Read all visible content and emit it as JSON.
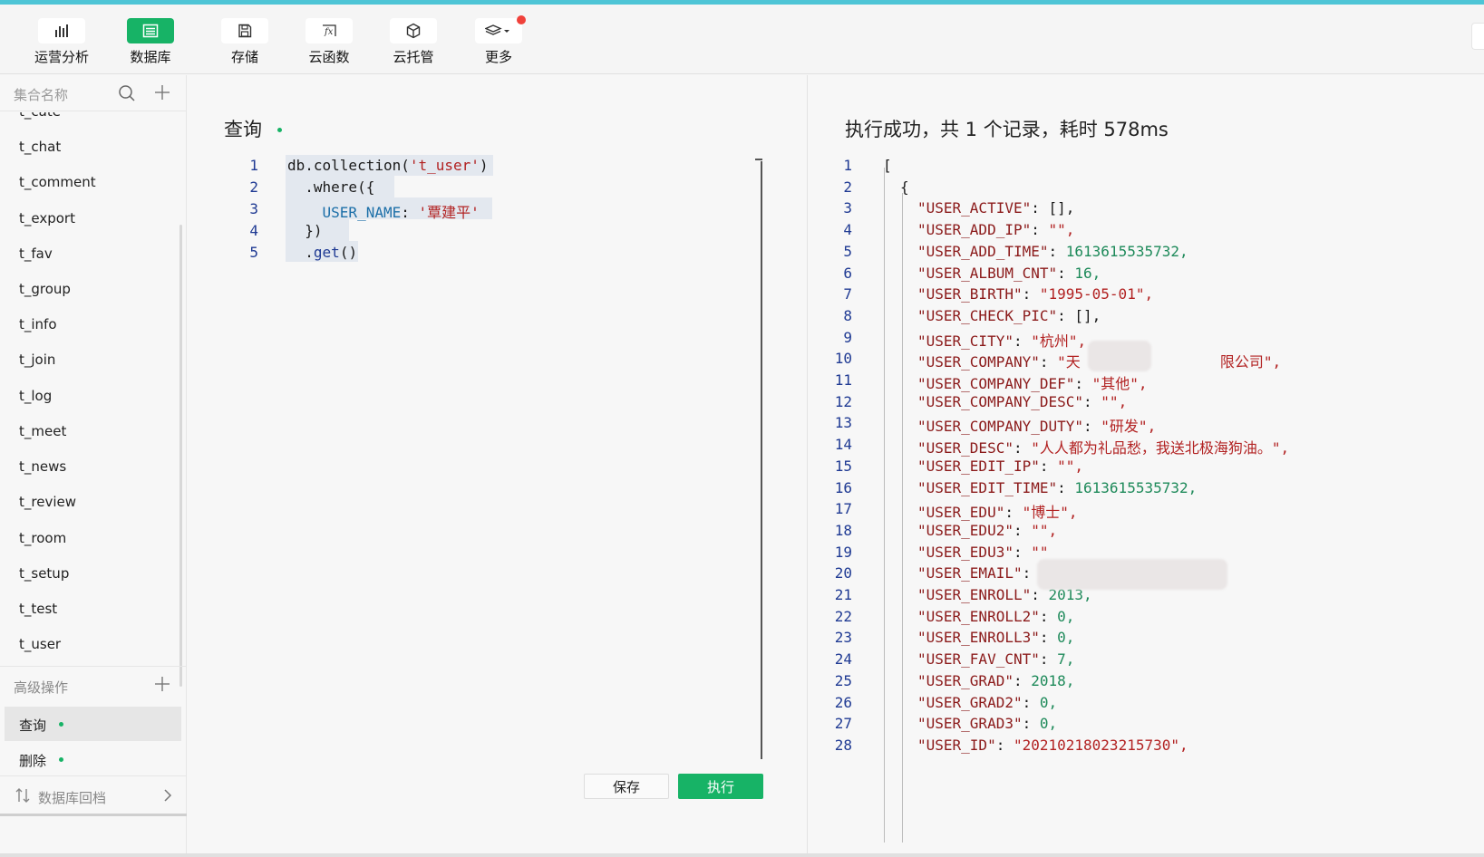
{
  "toolbar": {
    "items": [
      {
        "label": "运营分析",
        "icon": "bar-chart-icon"
      },
      {
        "label": "数据库",
        "icon": "database-icon",
        "active": true
      },
      {
        "label": "存储",
        "icon": "save-icon"
      },
      {
        "label": "云函数",
        "icon": "function-icon"
      },
      {
        "label": "云托管",
        "icon": "cube-icon"
      },
      {
        "label": "更多",
        "icon": "layers-icon"
      }
    ],
    "accent": "#17b366",
    "notify_color": "#f0413a"
  },
  "sidebar": {
    "search_placeholder": "集合名称",
    "collections": [
      "t_cate",
      "t_chat",
      "t_comment",
      "t_export",
      "t_fav",
      "t_group",
      "t_info",
      "t_join",
      "t_log",
      "t_meet",
      "t_news",
      "t_review",
      "t_room",
      "t_setup",
      "t_test",
      "t_user"
    ],
    "advanced_label": "高级操作",
    "operations": [
      {
        "label": "查询",
        "selected": true
      },
      {
        "label": "删除",
        "selected": false
      }
    ],
    "rollback_label": "数据库回档"
  },
  "editor": {
    "title": "查询",
    "line_numbers": [
      "1",
      "2",
      "3",
      "4",
      "5"
    ],
    "lines": [
      {
        "a": "db.collection(",
        "b": "'t_user'",
        "c": ")"
      },
      {
        "a": "  .where({"
      },
      {
        "a": "    ",
        "b": "USER_NAME",
        "c": ": ",
        "d": "'覃建平'"
      },
      {
        "a": "  })"
      },
      {
        "a": "  .",
        "b": "get",
        "c": "()"
      }
    ],
    "save_label": "保存",
    "run_label": "执行"
  },
  "result": {
    "title": "执行成功，共 1 个记录，耗时 578ms",
    "lines": [
      {
        "n": "1",
        "indent": 0,
        "raw": "["
      },
      {
        "n": "2",
        "indent": 1,
        "raw": "{"
      },
      {
        "n": "3",
        "indent": 2,
        "k": "\"USER_ACTIVE\"",
        "v": "[],",
        "t": "p"
      },
      {
        "n": "4",
        "indent": 2,
        "k": "\"USER_ADD_IP\"",
        "v": "\"\",",
        "t": "s"
      },
      {
        "n": "5",
        "indent": 2,
        "k": "\"USER_ADD_TIME\"",
        "v": "1613615535732,",
        "t": "n"
      },
      {
        "n": "6",
        "indent": 2,
        "k": "\"USER_ALBUM_CNT\"",
        "v": "16,",
        "t": "n"
      },
      {
        "n": "7",
        "indent": 2,
        "k": "\"USER_BIRTH\"",
        "v": "\"1995-05-01\",",
        "t": "s"
      },
      {
        "n": "8",
        "indent": 2,
        "k": "\"USER_CHECK_PIC\"",
        "v": "[],",
        "t": "p"
      },
      {
        "n": "9",
        "indent": 2,
        "k": "\"USER_CITY\"",
        "v": "\"杭州\",",
        "t": "s"
      },
      {
        "n": "10",
        "indent": 2,
        "k": "\"USER_COMPANY\"",
        "v": "\"天                限公司\",",
        "t": "s"
      },
      {
        "n": "11",
        "indent": 2,
        "k": "\"USER_COMPANY_DEF\"",
        "v": "\"其他\",",
        "t": "s"
      },
      {
        "n": "12",
        "indent": 2,
        "k": "\"USER_COMPANY_DESC\"",
        "v": "\"\",",
        "t": "s"
      },
      {
        "n": "13",
        "indent": 2,
        "k": "\"USER_COMPANY_DUTY\"",
        "v": "\"研发\",",
        "t": "s"
      },
      {
        "n": "14",
        "indent": 2,
        "k": "\"USER_DESC\"",
        "v": "\"人人都为礼品愁，我送北极海狗油。\",",
        "t": "s"
      },
      {
        "n": "15",
        "indent": 2,
        "k": "\"USER_EDIT_IP\"",
        "v": "\"\",",
        "t": "s"
      },
      {
        "n": "16",
        "indent": 2,
        "k": "\"USER_EDIT_TIME\"",
        "v": "1613615535732,",
        "t": "n"
      },
      {
        "n": "17",
        "indent": 2,
        "k": "\"USER_EDU\"",
        "v": "\"博士\",",
        "t": "s"
      },
      {
        "n": "18",
        "indent": 2,
        "k": "\"USER_EDU2\"",
        "v": "\"\",",
        "t": "s"
      },
      {
        "n": "19",
        "indent": 2,
        "k": "\"USER_EDU3\"",
        "v": "\"\"",
        "t": "s"
      },
      {
        "n": "20",
        "indent": 2,
        "k": "\"USER_EMAIL\"",
        "v": "",
        "t": "s"
      },
      {
        "n": "21",
        "indent": 2,
        "k": "\"USER_ENROLL\"",
        "v": "2013,",
        "t": "n"
      },
      {
        "n": "22",
        "indent": 2,
        "k": "\"USER_ENROLL2\"",
        "v": "0,",
        "t": "n"
      },
      {
        "n": "23",
        "indent": 2,
        "k": "\"USER_ENROLL3\"",
        "v": "0,",
        "t": "n"
      },
      {
        "n": "24",
        "indent": 2,
        "k": "\"USER_FAV_CNT\"",
        "v": "7,",
        "t": "n"
      },
      {
        "n": "25",
        "indent": 2,
        "k": "\"USER_GRAD\"",
        "v": "2018,",
        "t": "n"
      },
      {
        "n": "26",
        "indent": 2,
        "k": "\"USER_GRAD2\"",
        "v": "0,",
        "t": "n"
      },
      {
        "n": "27",
        "indent": 2,
        "k": "\"USER_GRAD3\"",
        "v": "0,",
        "t": "n"
      },
      {
        "n": "28",
        "indent": 2,
        "k": "\"USER_ID\"",
        "v": "\"20210218023215730\",",
        "t": "s"
      }
    ]
  }
}
